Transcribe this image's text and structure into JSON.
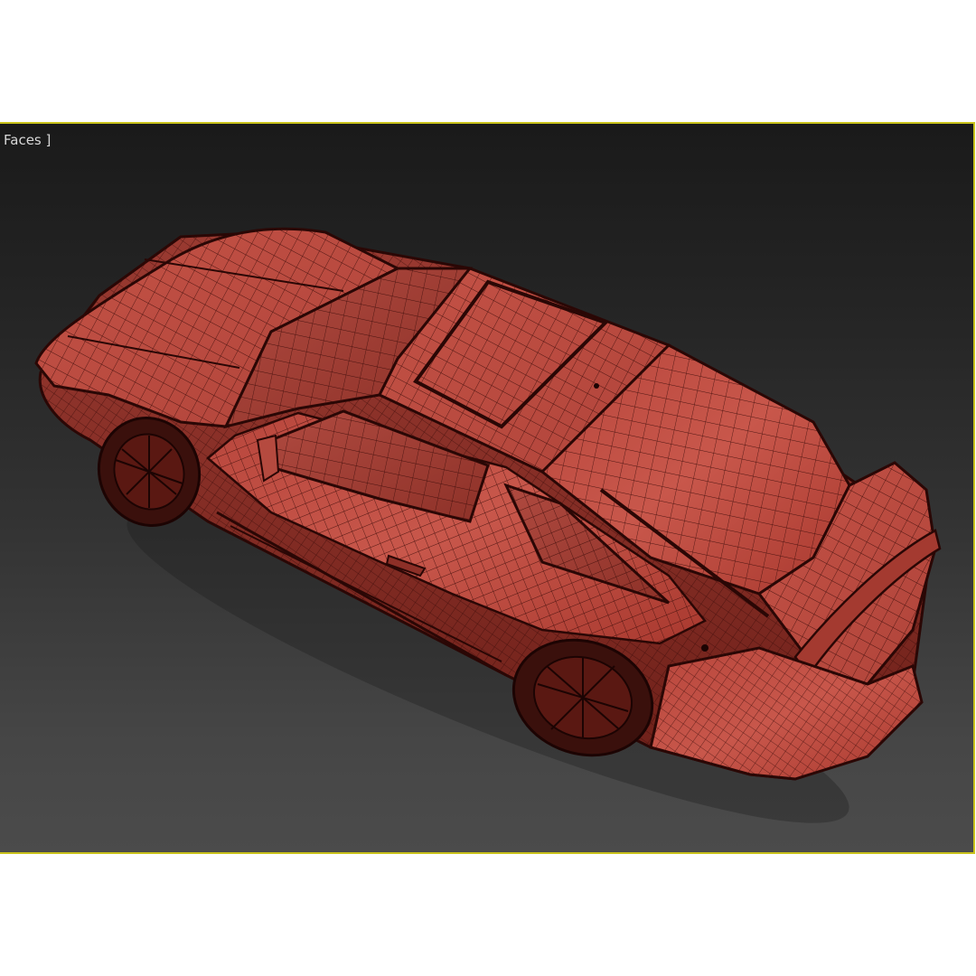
{
  "viewport": {
    "label": "Faces ]",
    "border_color": "#c9c21c",
    "background_top": "#1a1a1a",
    "background_bottom": "#4b4b4b"
  },
  "model": {
    "name": "car-wireframe-model",
    "shading_color": "#c0463c",
    "wire_color": "#3a0a08"
  }
}
